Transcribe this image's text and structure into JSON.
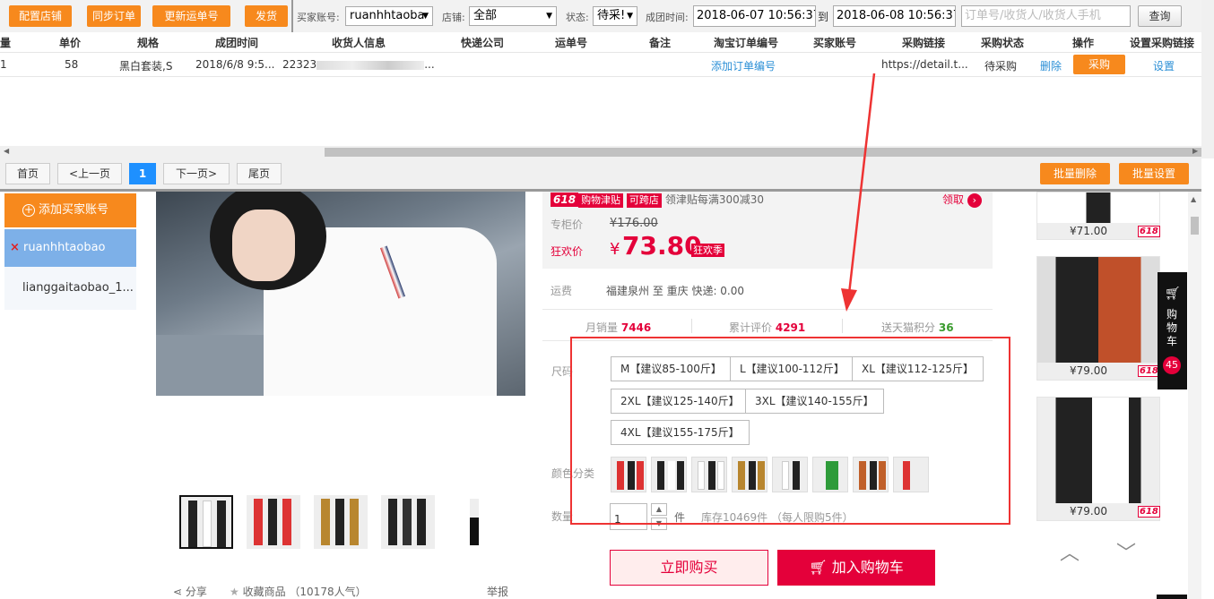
{
  "toolbar": {
    "buttons": [
      "配置店铺",
      "同步订单",
      "更新运单号",
      "发货"
    ],
    "buyer_label": "买家账号:",
    "buyer_value": "ruanhhtaoba",
    "shop_label": "店铺:",
    "shop_value": "全部",
    "status_label": "状态:",
    "status_value": "待采!",
    "time_label": "成团时间:",
    "time_from": "2018-06-07 10:56:37",
    "time_to_label": "到",
    "time_to": "2018-06-08 10:56:37",
    "search_placeholder": "订单号/收货人/收货人手机",
    "query_button": "查询"
  },
  "table": {
    "headers": [
      "量",
      "单价",
      "规格",
      "成团时间",
      "收货人信息",
      "快递公司",
      "运单号",
      "备注",
      "淘宝订单编号",
      "买家账号",
      "采购链接",
      "采购状态",
      "操作",
      "设置采购链接"
    ],
    "row": {
      "qty": "1",
      "price": "58",
      "spec": "黑白套装,S",
      "time": "2018/6/8 9:5...",
      "receiver": "22323",
      "receiver_tail": "...",
      "add_order": "添加订单编号",
      "link": "https://detail.t...",
      "status": "待采购",
      "delete": "删除",
      "purchase": "采购",
      "settings": "设置"
    }
  },
  "pager": {
    "first": "首页",
    "prev": "<上一页",
    "current": "1",
    "next": "下一页>",
    "last": "尾页",
    "batch_delete": "批量删除",
    "batch_settings": "批量设置"
  },
  "accounts": {
    "add_button": "添加买家账号",
    "items": [
      "ruanhhtaobao",
      "lianggaitaobao_1..."
    ],
    "remove_mark": "×"
  },
  "product": {
    "promo_tag": "618",
    "promo_tag2": "购物津贴",
    "promo_tag3": "可跨店",
    "promo_desc": "领津贴每满300减30",
    "claim": "领取",
    "orig_label": "专柜价",
    "orig_price": "¥176.00",
    "sale_label": "狂欢价",
    "currency": "¥",
    "sale_price": "73.80",
    "season_tag": "狂欢季",
    "ship_label": "运费",
    "ship_value": "福建泉州 至 重庆 快递: 0.00",
    "monthly_sales_label": "月销量",
    "monthly_sales": "7446",
    "reviews_label": "累计评价",
    "reviews": "4291",
    "points_label": "送天猫积分",
    "points": "36",
    "size_label": "尺码",
    "sizes": [
      "M【建议85-100斤】",
      "L【建议100-112斤】",
      "XL【建议112-125斤】",
      "2XL【建议125-140斤】",
      "3XL【建议140-155斤】",
      "4XL【建议155-175斤】"
    ],
    "color_label": "颜色分类",
    "qty_label": "数量",
    "qty_value": "1",
    "qty_unit": "件",
    "stock": "库存10469件 （每人限购5件）",
    "buy_now": "立即购买",
    "add_cart": "加入购物车",
    "share": "分享",
    "favorite": "收藏商品 （10178人气）",
    "report": "举报"
  },
  "sidebar_right": {
    "prices": [
      "¥71.00",
      "¥79.00",
      "¥79.00"
    ],
    "badge": "618",
    "cart_label": "购物车",
    "cart_count": "45"
  },
  "colors": {
    "orange": "#f7891d",
    "red": "#e4003a",
    "blue": "#2b8fd6",
    "account_active": "#7db0e8"
  }
}
